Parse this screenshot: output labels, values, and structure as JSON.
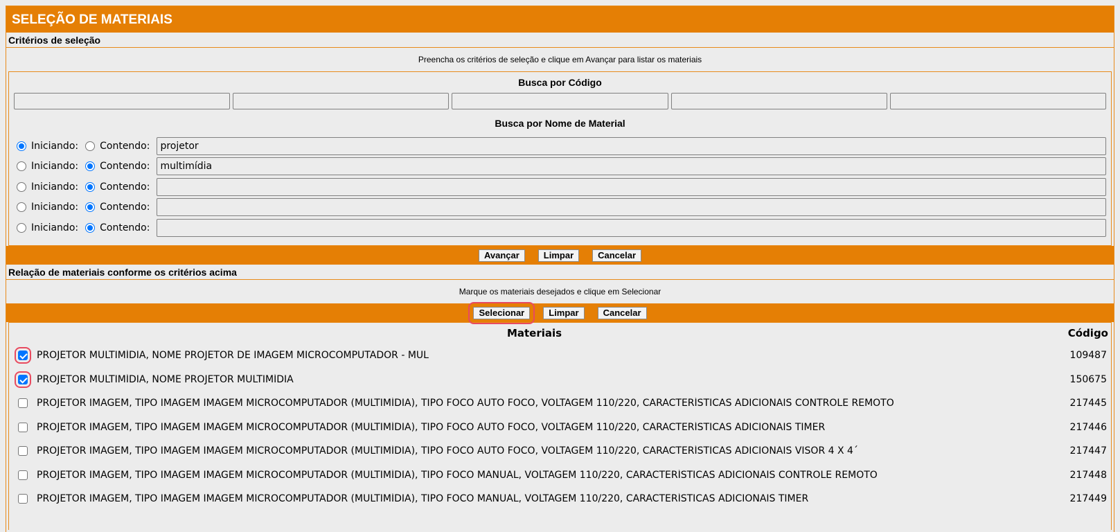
{
  "title": "SELEÇÃO DE MATERIAIS",
  "criteria": {
    "section_label": "Critérios de seleção",
    "hint": "Preencha os critérios de seleção e clique em Avançar para listar os materiais",
    "code_heading": "Busca por Código",
    "code_values": [
      "",
      "",
      "",
      "",
      ""
    ],
    "name_heading": "Busca por Nome de Material",
    "starting_label": "Iniciando:",
    "containing_label": "Contendo:",
    "name_rows": [
      {
        "mode": "iniciando",
        "value": "projetor"
      },
      {
        "mode": "contendo",
        "value": "multimídia"
      },
      {
        "mode": "contendo",
        "value": ""
      },
      {
        "mode": "contendo",
        "value": ""
      },
      {
        "mode": "contendo",
        "value": ""
      }
    ],
    "buttons": {
      "advance": "Avançar",
      "clear": "Limpar",
      "cancel": "Cancelar"
    }
  },
  "results": {
    "section_label": "Relação de materiais conforme os critérios acima",
    "hint": "Marque os materiais desejados e clique em Selecionar",
    "buttons": {
      "select": "Selecionar",
      "clear": "Limpar",
      "cancel": "Cancelar"
    },
    "col_materials": "Materiais",
    "col_code": "Código",
    "rows": [
      {
        "checked": true,
        "name": "PROJETOR MULTIMÍDIA, NOME PROJETOR DE IMAGEM MICROCOMPUTADOR - MUL",
        "code": "109487"
      },
      {
        "checked": true,
        "name": "PROJETOR MULTIMÍDIA, NOME PROJETOR MULTIMÍDIA",
        "code": "150675"
      },
      {
        "checked": false,
        "name": "PROJETOR IMAGEM, TIPO IMAGEM IMAGEM MICROCOMPUTADOR (MULTIMÍDIA), TIPO FOCO AUTO FOCO, VOLTAGEM 110/220, CARACTERÍSTICAS ADICIONAIS CONTROLE REMOTO",
        "code": "217445"
      },
      {
        "checked": false,
        "name": "PROJETOR IMAGEM, TIPO IMAGEM IMAGEM MICROCOMPUTADOR (MULTIMÍDIA), TIPO FOCO AUTO FOCO, VOLTAGEM 110/220, CARACTERÍSTICAS ADICIONAIS TIMER",
        "code": "217446"
      },
      {
        "checked": false,
        "name": "PROJETOR IMAGEM, TIPO IMAGEM IMAGEM MICROCOMPUTADOR (MULTIMÍDIA), TIPO FOCO AUTO FOCO, VOLTAGEM 110/220, CARACTERÍSTICAS ADICIONAIS VISOR 4 X 4´",
        "code": "217447"
      },
      {
        "checked": false,
        "name": "PROJETOR IMAGEM, TIPO IMAGEM IMAGEM MICROCOMPUTADOR (MULTIMÍDIA), TIPO FOCO MANUAL, VOLTAGEM 110/220, CARACTERÍSTICAS ADICIONAIS CONTROLE REMOTO",
        "code": "217448"
      },
      {
        "checked": false,
        "name": "PROJETOR IMAGEM, TIPO IMAGEM IMAGEM MICROCOMPUTADOR (MULTIMÍDIA), TIPO FOCO MANUAL, VOLTAGEM 110/220, CARACTERÍSTICAS ADICIONAIS TIMER",
        "code": "217449"
      }
    ]
  },
  "colors": {
    "accent": "#e57f05",
    "check_blue": "#0075ff",
    "highlight": "#e84a5f",
    "background": "#ececec"
  }
}
